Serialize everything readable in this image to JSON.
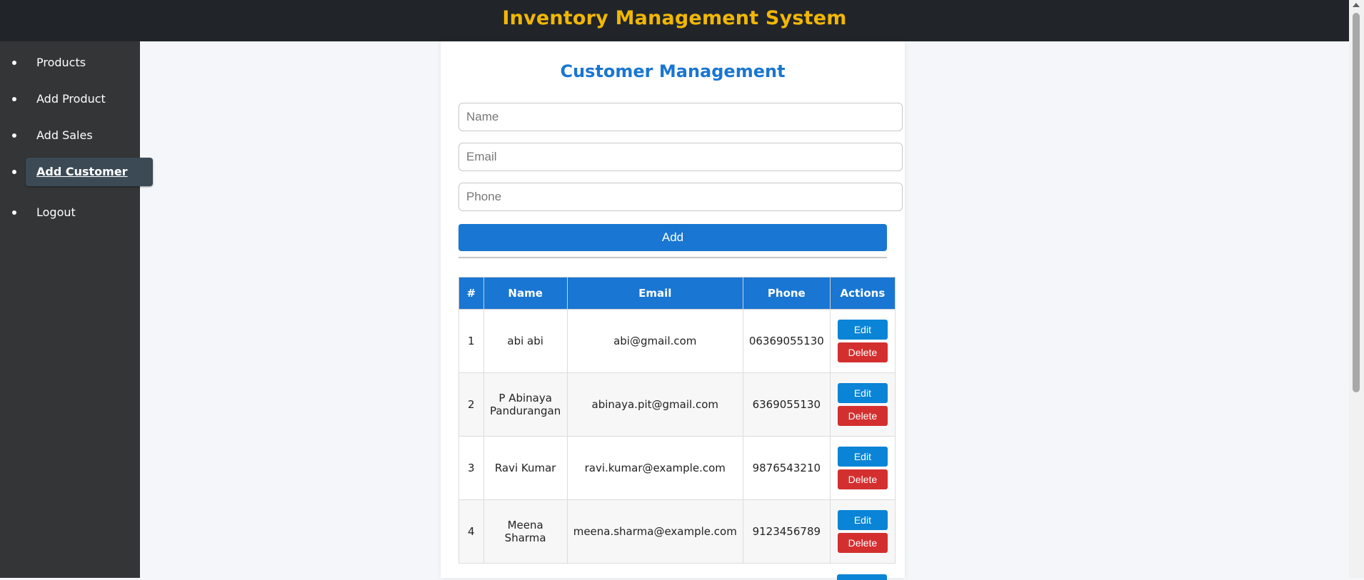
{
  "header": {
    "title": "Inventory Management System"
  },
  "sidebar": {
    "items": [
      {
        "label": "Products"
      },
      {
        "label": "Add Product"
      },
      {
        "label": "Add Sales"
      },
      {
        "label": "Add Customer",
        "active": true
      },
      {
        "label": "Logout"
      }
    ]
  },
  "main": {
    "title": "Customer Management",
    "form": {
      "name_placeholder": "Name",
      "email_placeholder": "Email",
      "phone_placeholder": "Phone",
      "add_label": "Add"
    },
    "table": {
      "columns": [
        "#",
        "Name",
        "Email",
        "Phone",
        "Actions"
      ],
      "rows": [
        {
          "num": "1",
          "name": "abi abi",
          "email": "abi@gmail.com",
          "phone": "06369055130"
        },
        {
          "num": "2",
          "name": "P Abinaya Pandurangan",
          "email": "abinaya.pit@gmail.com",
          "phone": "6369055130"
        },
        {
          "num": "3",
          "name": "Ravi Kumar",
          "email": "ravi.kumar@example.com",
          "phone": "9876543210"
        },
        {
          "num": "4",
          "name": "Meena Sharma",
          "email": "meena.sharma@example.com",
          "phone": "9123456789"
        }
      ],
      "edit_label": "Edit",
      "delete_label": "Delete"
    }
  },
  "colors": {
    "accent": "#1976d2",
    "title": "#f2b705",
    "delete": "#d32f2f",
    "edit": "#0a84d6"
  }
}
